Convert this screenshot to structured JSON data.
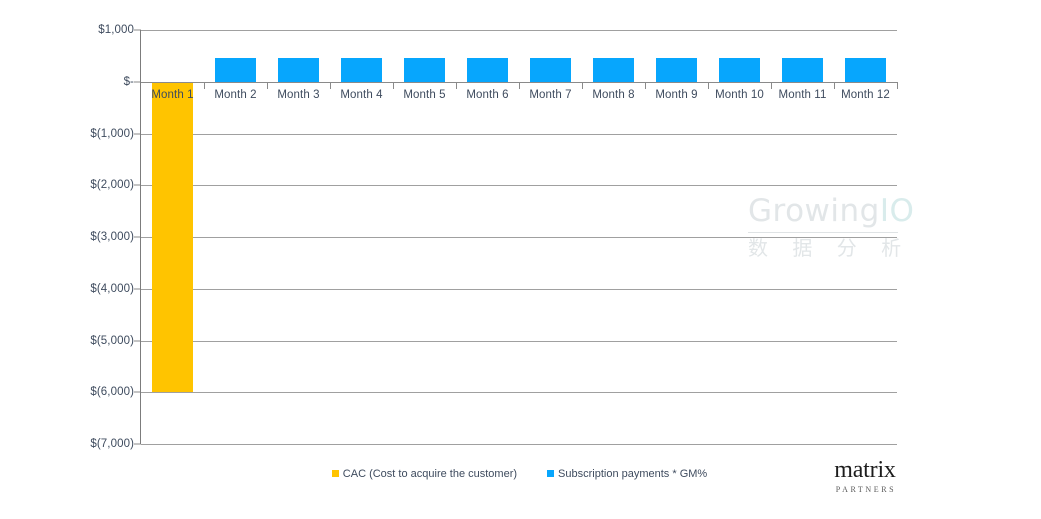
{
  "chart_data": {
    "type": "bar",
    "title": "",
    "subtitle": "",
    "xlabel": "",
    "ylabel": "",
    "categories": [
      "Month 1",
      "Month 2",
      "Month 3",
      "Month 4",
      "Month 5",
      "Month 6",
      "Month 7",
      "Month 8",
      "Month 9",
      "Month 10",
      "Month 11",
      "Month 12"
    ],
    "series": [
      {
        "name": "CAC (Cost to acquire the customer)",
        "color": "#FFC400",
        "values": [
          -6000,
          0,
          0,
          0,
          0,
          0,
          0,
          0,
          0,
          0,
          0,
          0
        ]
      },
      {
        "name": "Subscription payments * GM%",
        "color": "#07A6FD",
        "values": [
          0,
          460,
          460,
          460,
          460,
          460,
          460,
          460,
          460,
          460,
          460,
          460
        ]
      }
    ],
    "ylim": [
      -7000,
      1000
    ],
    "ytick_values": [
      1000,
      0,
      -1000,
      -2000,
      -3000,
      -4000,
      -5000,
      -6000,
      -7000
    ],
    "ytick_labels": [
      "$1,000",
      "$-",
      "$(1,000)",
      "$(2,000)",
      "$(3,000)",
      "$(4,000)",
      "$(5,000)",
      "$(6,000)",
      "$(7,000)"
    ],
    "grid": true,
    "legend_position": "bottom"
  },
  "legend": {
    "items": [
      {
        "label": "CAC (Cost to acquire the customer)",
        "color": "#FFC400"
      },
      {
        "label": "Subscription payments * GM%",
        "color": "#07A6FD"
      }
    ]
  },
  "watermark": {
    "brand": "Growing",
    "brand_suffix": "IO",
    "subtitle": "数 据 分 析"
  },
  "brand": {
    "name": "matrix",
    "tagline": "PARTNERS"
  }
}
